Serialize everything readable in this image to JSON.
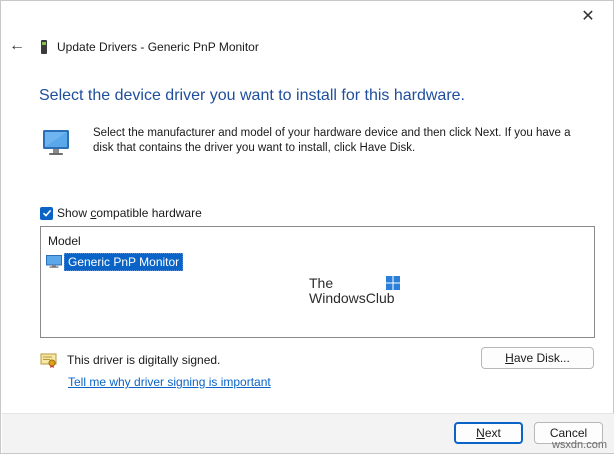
{
  "window": {
    "title": "Update Drivers - Generic PnP Monitor",
    "close_glyph": "✕",
    "back_glyph": "←"
  },
  "main": {
    "heading": "Select the device driver you want to install for this hardware.",
    "description": "Select the manufacturer and model of your hardware device and then click Next. If you have a disk that contains the driver you want to install, click Have Disk."
  },
  "compatible": {
    "checked": true,
    "label_prefix": "Show ",
    "label_access": "c",
    "label_suffix": "ompatible hardware"
  },
  "model_list": {
    "header": "Model",
    "items": [
      {
        "label": "Generic PnP Monitor",
        "selected": true
      }
    ]
  },
  "watermark": {
    "line1": "The",
    "line2": "WindowsClub"
  },
  "signing": {
    "status": "This driver is digitally signed.",
    "link": "Tell me why driver signing is important"
  },
  "buttons": {
    "have_disk_access": "H",
    "have_disk_rest": "ave Disk...",
    "next_access": "N",
    "next_rest": "ext",
    "cancel": "Cancel"
  },
  "corner_watermark": "wsxdn.com",
  "colors": {
    "accent": "#0a64c8",
    "heading": "#1e4e9c",
    "footer_bg": "#f3f3f3"
  },
  "icons": {
    "close": "close-icon",
    "back": "back-arrow-icon",
    "device": "device-icon",
    "monitor": "monitor-icon",
    "check": "checkmark-icon",
    "list_item": "monitor-small-icon",
    "signed": "certificate-icon"
  }
}
